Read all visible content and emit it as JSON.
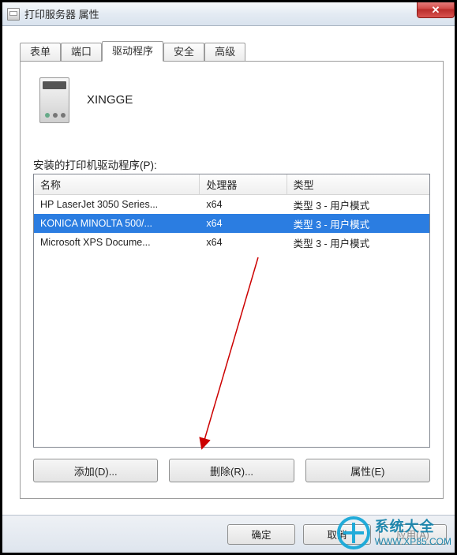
{
  "title": "打印服务器 属性",
  "tabs": {
    "forms": "表单",
    "ports": "端口",
    "drivers": "驱动程序",
    "security": "安全",
    "advanced": "高级"
  },
  "server_name": "XINGGE",
  "drivers_label": "安装的打印机驱动程序(P):",
  "columns": {
    "name": "名称",
    "processor": "处理器",
    "type": "类型"
  },
  "rows": [
    {
      "name": "HP LaserJet 3050 Series...",
      "proc": "x64",
      "type": "类型 3 - 用户模式",
      "selected": false
    },
    {
      "name": "KONICA MINOLTA 500/...",
      "proc": "x64",
      "type": "类型 3 - 用户模式",
      "selected": true
    },
    {
      "name": "Microsoft XPS Docume...",
      "proc": "x64",
      "type": "类型 3 - 用户模式",
      "selected": false
    }
  ],
  "buttons": {
    "add": "添加(D)...",
    "remove": "删除(R)...",
    "properties": "属性(E)"
  },
  "dlg": {
    "ok": "确定",
    "cancel": "取消",
    "apply": "应用(A)"
  },
  "watermark": {
    "title": "系统大全",
    "url": "WWW.XP85.COM"
  }
}
